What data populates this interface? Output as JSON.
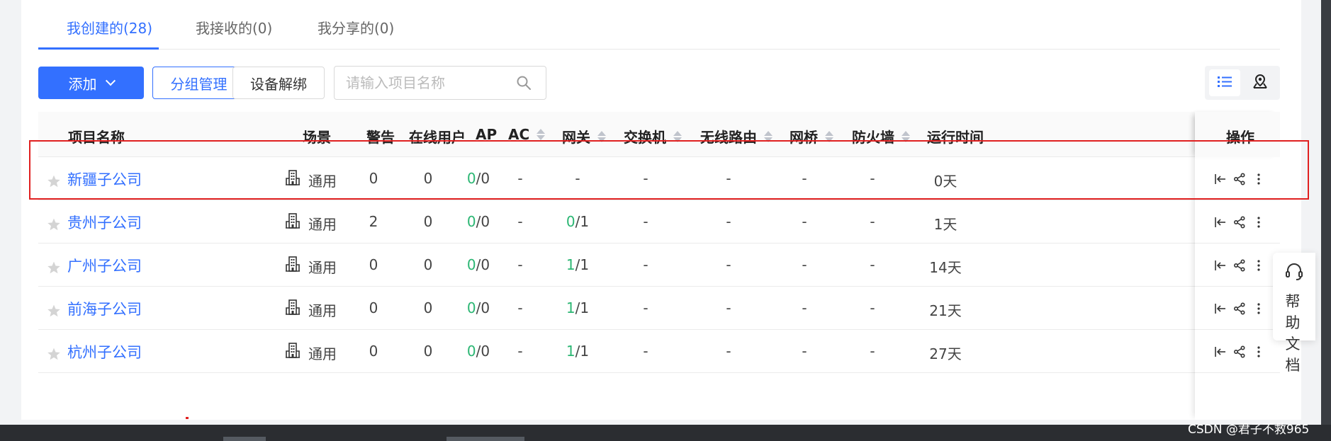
{
  "tabs": [
    {
      "label": "我创建的(28)",
      "active": true
    },
    {
      "label": "我接收的(0)",
      "active": false
    },
    {
      "label": "我分享的(0)",
      "active": false
    }
  ],
  "toolbar": {
    "add_label": "添加",
    "group_label": "分组管理",
    "unbind_label": "设备解绑",
    "search_placeholder": "请输入项目名称"
  },
  "columns": {
    "name": "项目名称",
    "scene": "场景",
    "alert": "警告",
    "online_users": "在线用户",
    "ap": "AP",
    "ac": "AC",
    "gateway": "网关",
    "switch": "交换机",
    "wireless_router": "无线路由",
    "bridge": "网桥",
    "firewall": "防火墙",
    "uptime": "运行时间",
    "ops": "操作"
  },
  "rows": [
    {
      "name": "新疆子公司",
      "scene": "通用",
      "alert": "0",
      "online": "0",
      "ap_on": "0",
      "ap_total": "/0",
      "ac": "-",
      "gw_on": "",
      "gw_total": "-",
      "switch": "-",
      "router": "-",
      "bridge": "-",
      "firewall": "-",
      "uptime": "0天"
    },
    {
      "name": "贵州子公司",
      "scene": "通用",
      "alert": "2",
      "online": "0",
      "ap_on": "0",
      "ap_total": "/0",
      "ac": "-",
      "gw_on": "0",
      "gw_total": "/1",
      "switch": "-",
      "router": "-",
      "bridge": "-",
      "firewall": "-",
      "uptime": "1天"
    },
    {
      "name": "广州子公司",
      "scene": "通用",
      "alert": "0",
      "online": "0",
      "ap_on": "0",
      "ap_total": "/0",
      "ac": "-",
      "gw_on": "1",
      "gw_total": "/1",
      "switch": "-",
      "router": "-",
      "bridge": "-",
      "firewall": "-",
      "uptime": "14天"
    },
    {
      "name": "前海子公司",
      "scene": "通用",
      "alert": "0",
      "online": "0",
      "ap_on": "0",
      "ap_total": "/0",
      "ac": "-",
      "gw_on": "1",
      "gw_total": "/1",
      "switch": "-",
      "router": "-",
      "bridge": "-",
      "firewall": "-",
      "uptime": "21天"
    },
    {
      "name": "杭州子公司",
      "scene": "通用",
      "alert": "0",
      "online": "0",
      "ap_on": "0",
      "ap_total": "/0",
      "ac": "-",
      "gw_on": "1",
      "gw_total": "/1",
      "switch": "-",
      "router": "-",
      "bridge": "-",
      "firewall": "-",
      "uptime": "27天"
    }
  ],
  "help": {
    "label": "帮助文档"
  },
  "watermark": "CSDN @君子不救965",
  "colors": {
    "accent": "#3370ff",
    "online_green": "#2bb673",
    "highlight_red": "#e02020"
  }
}
